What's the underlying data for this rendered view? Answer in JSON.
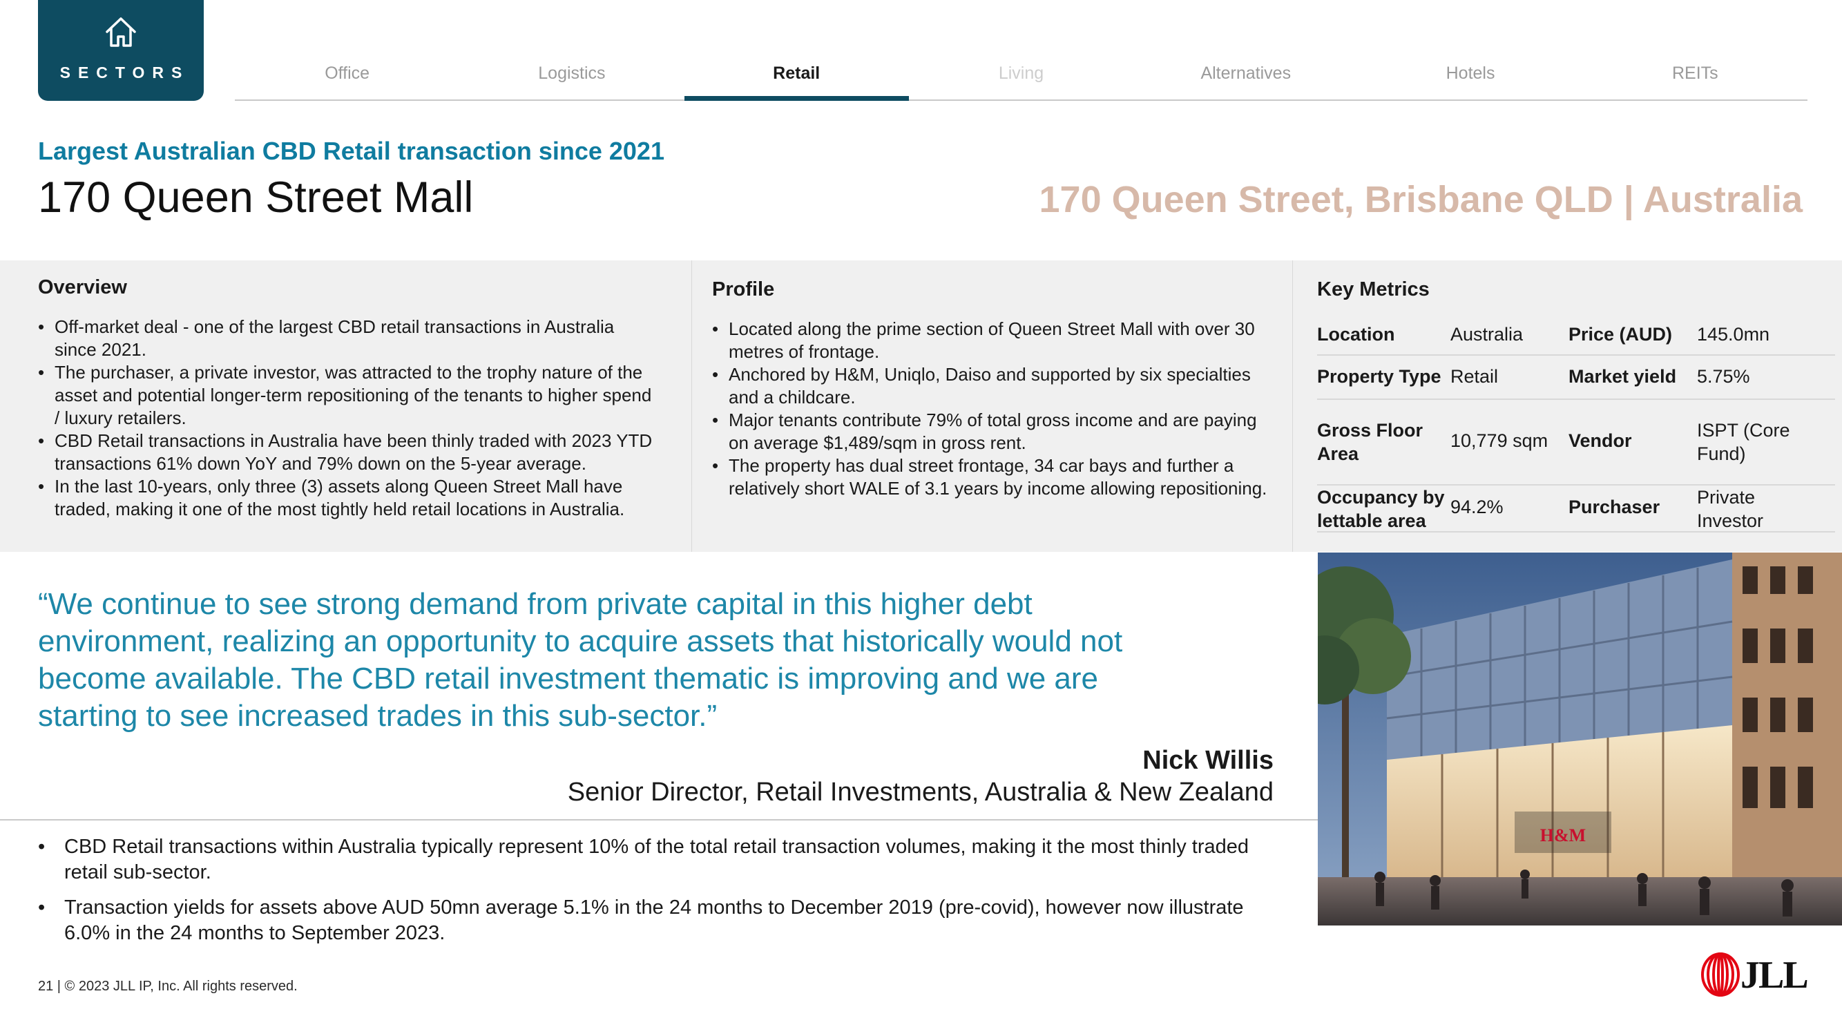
{
  "nav": {
    "badge_label": "SECTORS",
    "tabs": [
      {
        "label": "Office"
      },
      {
        "label": "Logistics"
      },
      {
        "label": "Retail"
      },
      {
        "label": "Living"
      },
      {
        "label": "Alternatives"
      },
      {
        "label": "Hotels"
      },
      {
        "label": "REITs"
      }
    ],
    "active_tab": "Retail",
    "accent_color": "#0e4c61"
  },
  "header": {
    "subtitle": "Largest Australian CBD Retail transaction since 2021",
    "title": "170 Queen Street Mall",
    "location": "170 Queen Street, Brisbane QLD | Australia"
  },
  "overview": {
    "heading": "Overview",
    "bullets": [
      "Off-market deal - one of the largest CBD retail transactions in Australia since 2021.",
      "The purchaser, a private investor, was attracted to the trophy nature of the asset and potential longer-term repositioning of the tenants to higher spend / luxury retailers.",
      "CBD Retail transactions in Australia have been thinly traded with 2023 YTD transactions 61% down YoY and 79% down on the 5-year average.",
      "In the last 10-years, only three (3) assets along Queen Street Mall have traded, making it one of the most tightly held retail locations in Australia."
    ]
  },
  "profile": {
    "heading": "Profile",
    "bullets": [
      "Located along the prime section of Queen Street Mall with over 30 metres of frontage.",
      "Anchored by H&M, Uniqlo, Daiso and supported by six specialties and a childcare.",
      "Major tenants contribute 79% of total gross income and are paying on average $1,489/sqm in gross rent.",
      "The property has dual street frontage, 34 car bays and further a relatively short WALE of 3.1 years by income allowing repositioning."
    ]
  },
  "metrics": {
    "heading": "Key Metrics",
    "rows": [
      {
        "label1": "Location",
        "value1": "Australia",
        "label2": "Price (AUD)",
        "value2": "145.0mn"
      },
      {
        "label1": "Property Type",
        "value1": "Retail",
        "label2": "Market yield",
        "value2": "5.75%"
      },
      {
        "label1": "Gross Floor Area",
        "value1": "10,779 sqm",
        "label2": "Vendor",
        "value2": "ISPT (Core Fund)"
      },
      {
        "label1": "Occupancy by lettable area",
        "value1": "94.2%",
        "label2": "Purchaser",
        "value2": "Private Investor"
      }
    ]
  },
  "quote": {
    "text": "“We continue to see strong demand from private capital in this higher debt environment, realizing an opportunity to acquire assets that historically would not become available. The CBD retail investment thematic is improving and we are starting to see increased trades in this sub-sector.”",
    "name": "Nick Willis",
    "role": "Senior Director, Retail Investments, Australia & New Zealand",
    "color": "#1d87a8"
  },
  "footer_bullets": [
    "CBD Retail transactions within Australia typically represent 10% of the total retail transaction volumes, making it the most thinly traded retail sub-sector.",
    "Transaction yields for assets above AUD 50mn average 5.1% in the 24 months to December 2019 (pre-covid), however now illustrate 6.0% in the 24 months to September 2023."
  ],
  "footer": {
    "copyright": "21 | © 2023 JLL IP, Inc. All rights reserved.",
    "logo_text": "JLL",
    "logo_color": "#e30613"
  },
  "photo": {
    "storefront_sign": "H&M"
  }
}
